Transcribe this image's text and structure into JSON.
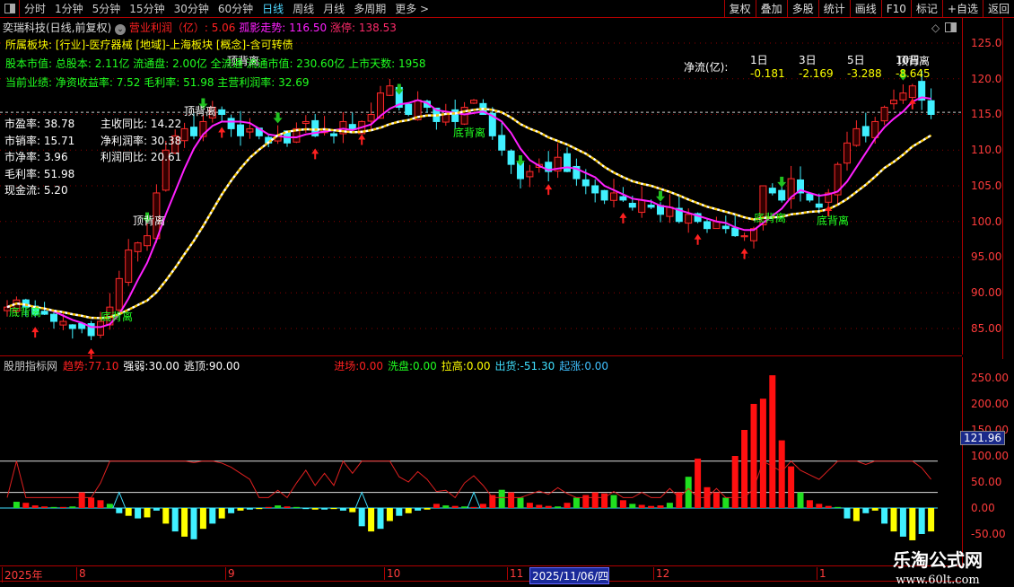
{
  "toolbar": {
    "timeframes": [
      "分时",
      "1分钟",
      "5分钟",
      "15分钟",
      "30分钟",
      "60分钟",
      "日线",
      "周线",
      "月线",
      "多周期",
      "更多 >"
    ],
    "active": "日线",
    "buttons": [
      "复权",
      "叠加",
      "多股",
      "统计",
      "画线",
      "F10",
      "标记",
      "+自选",
      "返回"
    ]
  },
  "header": {
    "stock": "奕瑞科技(日线,前复权)",
    "profit_label": "营业利润（亿）:",
    "profit": "5.06",
    "trend_label": "孤影走势:",
    "trend": "116.50",
    "limit_label": "涨停:",
    "limit": "138.53"
  },
  "info": {
    "sector": "所属板块: [行业]-医疗器械 [地域]-上海板块 [概念]-含可转债",
    "capital": "股本市值: 总股本: 2.11亿 流通盘: 2.00亿 全流通 流通市值: 230.60亿 上市天数: 1958",
    "perf": "当前业绩: 净资收益率: 7.52 毛利率: 51.98 主营利润率: 32.69"
  },
  "ratios_left": [
    "市盈率: 38.78",
    "市销率: 15.71",
    "市净率: 3.96",
    "毛利率: 51.98",
    "现金流: 5.20"
  ],
  "ratios_right": [
    "主收同比: 14.22",
    "净利润率: 30.38",
    "利润同比: 20.61"
  ],
  "netflow": {
    "label": "净流(亿):",
    "periods": [
      "1日",
      "3日",
      "5日",
      "10日"
    ],
    "values": [
      "-0.181",
      "-2.169",
      "-3.288",
      "-8.645"
    ]
  },
  "annotations": {
    "top": "顶背离",
    "bottom": "底背离"
  },
  "price_axis": [
    "125.0",
    "120.0",
    "115.0",
    "110.0",
    "105.0",
    "100.0",
    "95.00",
    "90.00",
    "85.00"
  ],
  "sub_axis": [
    "250.00",
    "200.00",
    "150.00",
    "100.00",
    "50.00",
    "0.00",
    "-50.00"
  ],
  "sub_marker": "121.96",
  "indicator": {
    "name": "股朋指标网",
    "items": [
      {
        "label": "趋势:",
        "value": "77.10",
        "color": "#ff2020"
      },
      {
        "label": "强弱:",
        "value": "30.00",
        "color": "#ffffff"
      },
      {
        "label": "逃顶:",
        "value": "90.00",
        "color": "#ffffff"
      },
      {
        "label": "进场:",
        "value": "0.00",
        "color": "#ff2020"
      },
      {
        "label": "洗盘:",
        "value": "0.00",
        "color": "#20ff20"
      },
      {
        "label": "拉高:",
        "value": "0.00",
        "color": "#ffff00"
      },
      {
        "label": "出货:",
        "value": "-51.30",
        "color": "#40e0ff"
      },
      {
        "label": "起涨:",
        "value": "0.00",
        "color": "#40c0ff"
      }
    ]
  },
  "dates": [
    "2025年",
    "8",
    "9",
    "10",
    "11",
    "2025/11/06/四",
    "12",
    "1"
  ],
  "watermark": {
    "name": "乐淘公式网",
    "url": "www.60lt.com"
  },
  "colors": {
    "up": "#ff2a2a",
    "down": "#40f0ff",
    "ma_short": "#ff20ff",
    "grid": "#b00000"
  },
  "kline_close": [
    88,
    89,
    88,
    87,
    87,
    86,
    86,
    85,
    85,
    84,
    86,
    88,
    92,
    96,
    97,
    98,
    104,
    110,
    112,
    113,
    112,
    114,
    116,
    115,
    113,
    112,
    113,
    112,
    111,
    112,
    111,
    113,
    114,
    112,
    113,
    112,
    114,
    113,
    114,
    115,
    118,
    119,
    116,
    115,
    117,
    116,
    114,
    115,
    114,
    116,
    117,
    115,
    112,
    110,
    108,
    106,
    107,
    108,
    107,
    109,
    107,
    106,
    105,
    104,
    103,
    104,
    103,
    102,
    103,
    102,
    101,
    102,
    100,
    101,
    100,
    99,
    100,
    99,
    98,
    98,
    99,
    105,
    104,
    103,
    106,
    104,
    103,
    102,
    104,
    108,
    111,
    113,
    112,
    114,
    116,
    117,
    118,
    119,
    117,
    115
  ],
  "indicator_bars": [
    0,
    12,
    10,
    5,
    3,
    2,
    2,
    3,
    30,
    20,
    15,
    8,
    -10,
    -15,
    -20,
    -18,
    -5,
    -30,
    -45,
    -55,
    -60,
    -40,
    -30,
    -20,
    -10,
    -5,
    -3,
    -2,
    2,
    5,
    3,
    2,
    -2,
    -3,
    -3,
    -2,
    -5,
    -8,
    -35,
    -45,
    -40,
    -25,
    -15,
    -10,
    -5,
    -3,
    8,
    5,
    4,
    3,
    2,
    8,
    25,
    35,
    30,
    20,
    10,
    6,
    4,
    3,
    10,
    20,
    25,
    30,
    28,
    25,
    15,
    8,
    6,
    4,
    5,
    10,
    30,
    60,
    95,
    40,
    30,
    20,
    100,
    150,
    200,
    210,
    255,
    130,
    80,
    30,
    15,
    8,
    4,
    2,
    -20,
    -25,
    -10,
    -5,
    -30,
    -45,
    -55,
    -62,
    -50,
    -45
  ]
}
